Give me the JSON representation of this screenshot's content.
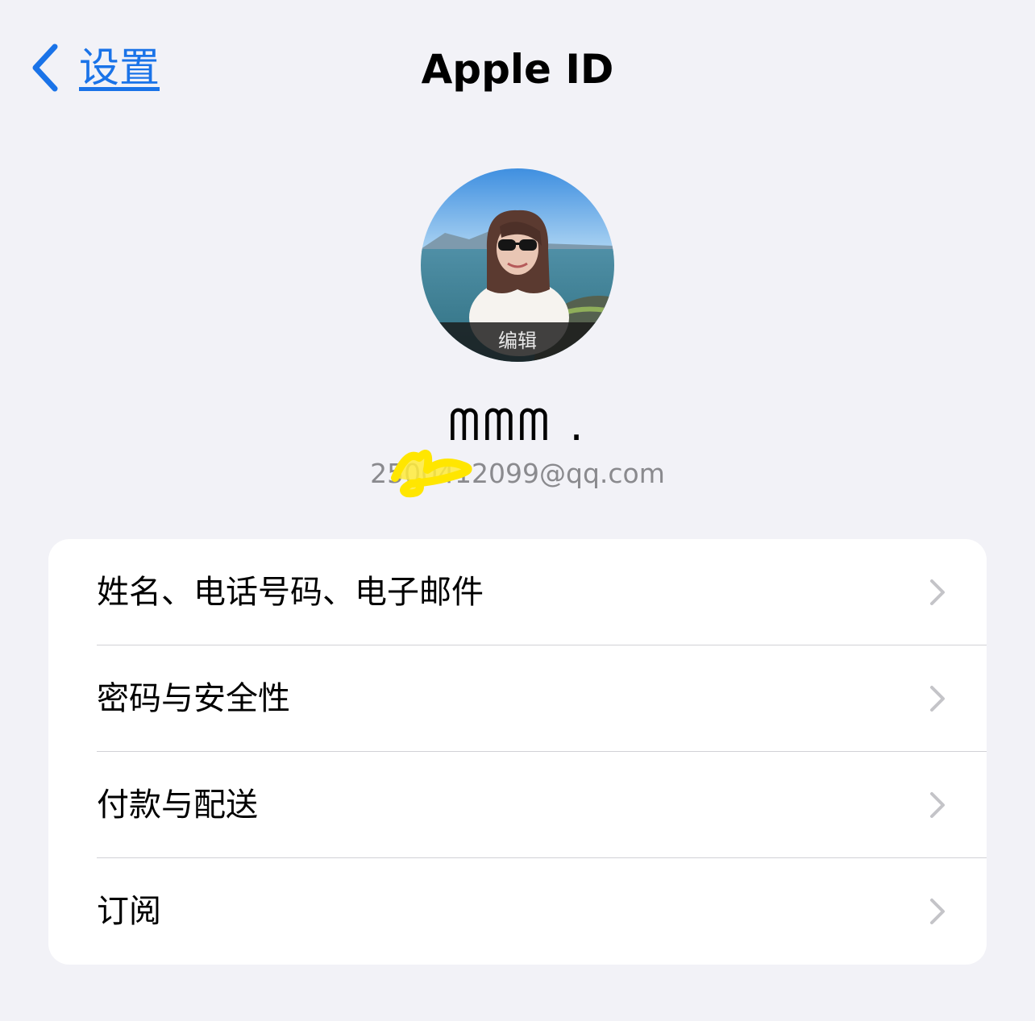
{
  "nav": {
    "back_label": "设置",
    "title": "Apple ID"
  },
  "profile": {
    "avatar_edit_label": "编辑",
    "name": "ᗰᗰᗰ .",
    "email": "2500412099@qq.com"
  },
  "menu": {
    "items": [
      {
        "label": "姓名、电话号码、电子邮件"
      },
      {
        "label": "密码与安全性"
      },
      {
        "label": "付款与配送"
      },
      {
        "label": "订阅"
      }
    ]
  },
  "colors": {
    "background": "#f2f2f7",
    "accent": "#1a73e8",
    "card": "#ffffff",
    "secondary_text": "#8a8a8e",
    "chevron": "#c4c4c8",
    "scribble": "#ffeb3b"
  },
  "icons": {
    "back": "chevron-left-icon",
    "row": "chevron-right-icon"
  }
}
